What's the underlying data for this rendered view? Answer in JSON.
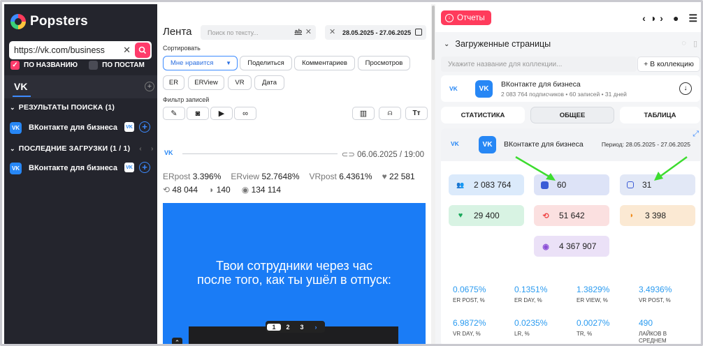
{
  "sidebar": {
    "brand": "Popsters",
    "search_value": "https://vk.com/business",
    "filter_by_name": "ПО НАЗВАНИЮ",
    "filter_by_posts": "ПО ПОСТАМ",
    "tab_vk": "VK",
    "search_results_title": "РЕЗУЛЬТАТЫ ПОИСКА (1)",
    "search_result_item": "ВКонтакте для бизнеса",
    "recent_title": "ПОСЛЕДНИЕ ЗАГРУЗКИ (1 / 1)",
    "recent_item": "ВКонтакте для бизнеса"
  },
  "feed": {
    "title": "Лента",
    "search_placeholder": "Поиск по тексту...",
    "search_ab": "ab",
    "date_range": "28.05.2025 - 27.06.2025",
    "sort_label": "Сортировать",
    "sort_buttons": [
      "Мне нравится",
      "Поделиться",
      "Комментариев",
      "Просмотров"
    ],
    "metric_buttons": [
      "ER",
      "ERView",
      "VR",
      "Дата"
    ],
    "filter_label": "Фильтр записей",
    "post": {
      "network": "VK",
      "date": "06.06.2025 / 19:00",
      "er_post_label": "ERpost",
      "er_post": "3.396%",
      "er_view_label": "ERview",
      "er_view": "52.7648%",
      "vr_post_label": "VRpost",
      "vr_post": "6.4361%",
      "likes": "22 581",
      "reposts": "48 044",
      "comments": "140",
      "views": "134 114",
      "image_text_line1": "Твои сотрудники через час",
      "image_text_line2": "после того, как ты ушёл в отпуск:",
      "pages": [
        "1",
        "2",
        "3"
      ]
    }
  },
  "right": {
    "reports_label": "Отчеты",
    "loaded_title": "Загруженные страницы",
    "collection_placeholder": "Укажите название для коллекции...",
    "add_collection": "+ В коллекцию",
    "source": {
      "network": "VK",
      "name": "ВКонтакте для бизнеса",
      "sub": "2 083 764 подписчиков • 60 записей • 31 дней"
    },
    "tabs": [
      "СТАТИСТИКА",
      "ОБЩЕЕ",
      "ТАБЛИЦА"
    ],
    "card": {
      "network": "VK",
      "name": "ВКонтакте для бизнеса",
      "period": "Период: 28.05.2025 - 27.06.2025",
      "subscribers": "2 083 764",
      "posts": "60",
      "days": "31",
      "likes": "29 400",
      "reposts": "51 642",
      "comments": "3 398",
      "views": "4 367 907"
    },
    "stats": [
      {
        "value": "0.0675%",
        "label": "ER POST, %"
      },
      {
        "value": "0.1351%",
        "label": "ER DAY, %"
      },
      {
        "value": "1.3829%",
        "label": "ER VIEW, %"
      },
      {
        "value": "3.4936%",
        "label": "VR POST, %"
      },
      {
        "value": "6.9872%",
        "label": "VR DAY, %"
      },
      {
        "value": "0.0235%",
        "label": "LR, %"
      },
      {
        "value": "0.0027%",
        "label": "TR, %"
      },
      {
        "value": "490",
        "label": "ЛАЙКОВ В СРЕДНЕМ"
      }
    ]
  },
  "colors": {
    "accent": "#3d8bff",
    "brand": "#ff3b5c",
    "vk": "#2787f5",
    "sidebar": "#24252d",
    "annotation_arrow": "#3ddc2f"
  }
}
